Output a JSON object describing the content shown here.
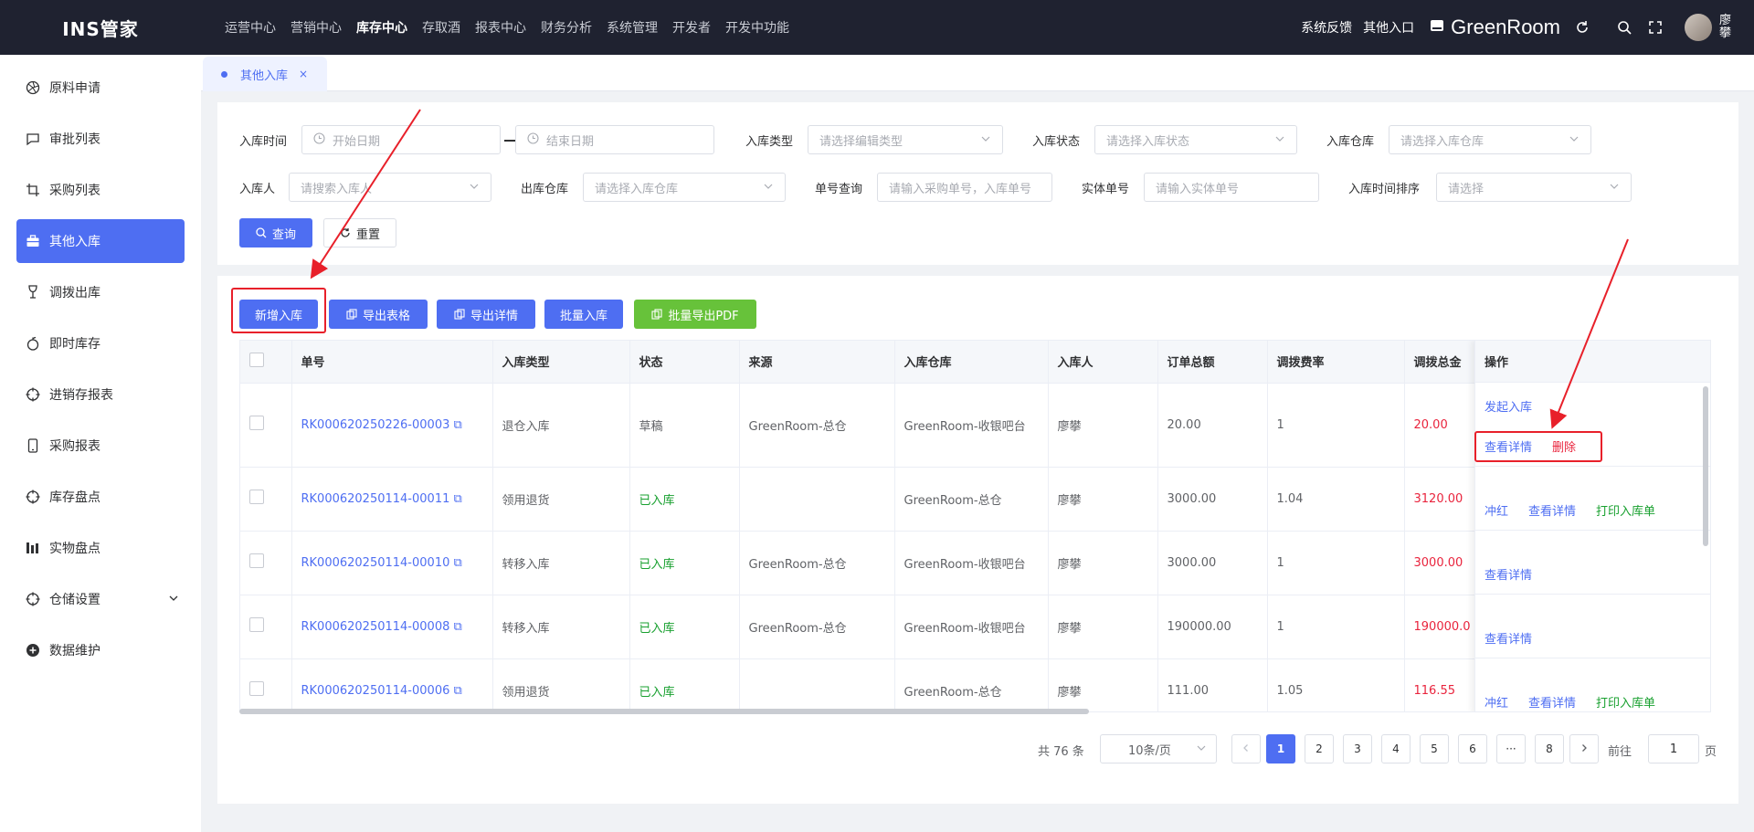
{
  "app": {
    "title": "INS管家"
  },
  "topnav": [
    "运营中心",
    "营销中心",
    "库存中心",
    "存取酒",
    "报表中心",
    "财务分析",
    "系统管理",
    "开发者",
    "开发中功能"
  ],
  "topnav_active": "库存中心",
  "topright": {
    "feedback": "系统反馈",
    "other_entry": "其他入口",
    "store": "GreenRoom",
    "user": "廖攀"
  },
  "sidebar": [
    {
      "label": "原料申请",
      "icon": "aperture-icon"
    },
    {
      "label": "审批列表",
      "icon": "chat-icon"
    },
    {
      "label": "采购列表",
      "icon": "crop-icon"
    },
    {
      "label": "其他入库",
      "icon": "briefcase-icon",
      "active": true
    },
    {
      "label": "调拨出库",
      "icon": "wine-glass-icon"
    },
    {
      "label": "即时库存",
      "icon": "apple-icon"
    },
    {
      "label": "进销存报表",
      "icon": "target-icon"
    },
    {
      "label": "采购报表",
      "icon": "phone-icon"
    },
    {
      "label": "库存盘点",
      "icon": "target-icon"
    },
    {
      "label": "实物盘点",
      "icon": "bar-chart-icon"
    },
    {
      "label": "仓储设置",
      "icon": "target-icon",
      "expandable": true
    },
    {
      "label": "数据维护",
      "icon": "plus-circle-icon"
    }
  ],
  "tab": {
    "label": "其他入库",
    "close": "×"
  },
  "filters": {
    "in_time": {
      "label": "入库时间",
      "start": "开始日期",
      "end": "结束日期"
    },
    "in_type": {
      "label": "入库类型",
      "placeholder": "请选择编辑类型"
    },
    "in_status": {
      "label": "入库状态",
      "placeholder": "请选择入库状态"
    },
    "in_warehouse": {
      "label": "入库仓库",
      "placeholder": "请选择入库仓库"
    },
    "in_person": {
      "label": "入库人",
      "placeholder": "请搜索入库人"
    },
    "out_warehouse": {
      "label": "出库仓库",
      "placeholder": "请选择入库仓库"
    },
    "order_query": {
      "label": "单号查询",
      "placeholder": "请输入采购单号，入库单号"
    },
    "entity_no": {
      "label": "实体单号",
      "placeholder": "请输入实体单号"
    },
    "time_sort": {
      "label": "入库时间排序",
      "placeholder": "请选择"
    },
    "query_btn": "查询",
    "reset_btn": "重置"
  },
  "actions": {
    "add": "新增入库",
    "export_table": "导出表格",
    "export_detail": "导出详情",
    "batch_in": "批量入库",
    "batch_pdf": "批量导出PDF"
  },
  "columns": [
    "单号",
    "入库类型",
    "状态",
    "来源",
    "入库仓库",
    "入库人",
    "订单总额",
    "调拨费率",
    "调拨总金",
    "操作"
  ],
  "rows": [
    {
      "no": "RK000620250226-00003",
      "type": "退仓入库",
      "status": "草稿",
      "source": "GreenRoom-总仓",
      "warehouse": "GreenRoom-收银吧台",
      "person": "廖攀",
      "total": "20.00",
      "rate": "1",
      "amount": "20.00"
    },
    {
      "no": "RK000620250114-00011",
      "type": "领用退货",
      "status": "已入库",
      "source": "",
      "warehouse": "GreenRoom-总仓",
      "person": "廖攀",
      "total": "3000.00",
      "rate": "1.04",
      "amount": "3120.00"
    },
    {
      "no": "RK000620250114-00010",
      "type": "转移入库",
      "status": "已入库",
      "source": "GreenRoom-总仓",
      "warehouse": "GreenRoom-收银吧台",
      "person": "廖攀",
      "total": "3000.00",
      "rate": "1",
      "amount": "3000.00"
    },
    {
      "no": "RK000620250114-00008",
      "type": "转移入库",
      "status": "已入库",
      "source": "GreenRoom-总仓",
      "warehouse": "GreenRoom-收银吧台",
      "person": "廖攀",
      "total": "190000.00",
      "rate": "1",
      "amount": "190000.0"
    },
    {
      "no": "RK000620250114-00006",
      "type": "领用退货",
      "status": "已入库",
      "source": "",
      "warehouse": "GreenRoom-总仓",
      "person": "廖攀",
      "total": "111.00",
      "rate": "1.05",
      "amount": "116.55"
    }
  ],
  "ops": {
    "initiate": "发起入库",
    "detail": "查看详情",
    "delete": "删除",
    "reverse": "冲红",
    "print": "打印入库单"
  },
  "pagination": {
    "total": "共 76 条",
    "page_size": "10条/页",
    "pages": [
      "1",
      "2",
      "3",
      "4",
      "5",
      "6",
      "···",
      "8"
    ],
    "current": "1",
    "goto_label": "前往",
    "goto_value": "1",
    "goto_unit": "页"
  },
  "watermark": "廖攀",
  "colors": {
    "primary": "#4e6ef2",
    "green_btn": "#67c23a",
    "status_green": "#18a02f",
    "amount_red": "#e9243d",
    "annotation_red": "#e8202a",
    "topbar": "#1f2230"
  }
}
